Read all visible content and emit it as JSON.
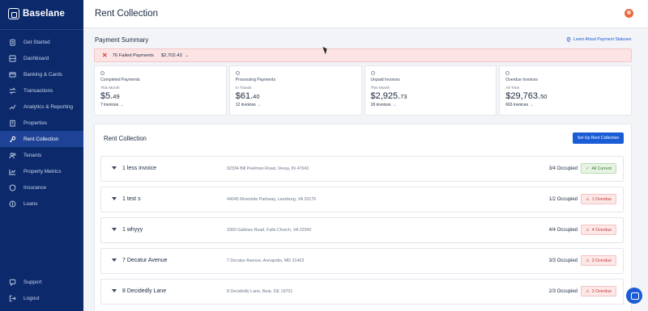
{
  "brand": {
    "name": "Baselane"
  },
  "header": {
    "title": "Rent Collection"
  },
  "sidebar": {
    "items": [
      {
        "label": "Get Started",
        "icon": "clipboard-icon",
        "active": false
      },
      {
        "label": "Dashboard",
        "icon": "dashboard-icon",
        "active": false
      },
      {
        "label": "Banking & Cards",
        "icon": "bank-icon",
        "active": false
      },
      {
        "label": "Transactions",
        "icon": "transactions-icon",
        "active": false
      },
      {
        "label": "Analytics & Reporting",
        "icon": "analytics-icon",
        "active": false
      },
      {
        "label": "Properties",
        "icon": "properties-icon",
        "active": false
      },
      {
        "label": "Rent Collection",
        "icon": "key-icon",
        "active": true
      },
      {
        "label": "Tenants",
        "icon": "tenants-icon",
        "active": false
      },
      {
        "label": "Property Metrics",
        "icon": "metrics-icon",
        "active": false
      },
      {
        "label": "Insurance",
        "icon": "shield-icon",
        "active": false
      },
      {
        "label": "Loans",
        "icon": "loans-icon",
        "active": false
      }
    ],
    "bottom": [
      {
        "label": "Support",
        "icon": "support-icon"
      },
      {
        "label": "Logout",
        "icon": "logout-icon"
      }
    ]
  },
  "payment_summary": {
    "title": "Payment Summary",
    "link": "Learn About Payment Statuses",
    "failed": {
      "label": "76 Failed Payments",
      "amount": "$2,702.43",
      "arrow": "→"
    },
    "cards": [
      {
        "title": "Completed Payments",
        "period": "This Month",
        "amount_main": "$5.",
        "amount_cents": "49",
        "link": "7 invoices  →"
      },
      {
        "title": "Processing Payments",
        "period": "In Transit",
        "amount_main": "$61.",
        "amount_cents": "40",
        "link": "12 invoices  →"
      },
      {
        "title": "Unpaid Invoices",
        "period": "This Month",
        "amount_main": "$2,925.",
        "amount_cents": "73",
        "link": "18 invoices  →"
      },
      {
        "title": "Overdue Invoices",
        "period": "All Time",
        "amount_main": "$29,763.",
        "amount_cents": "50",
        "link": "663 invoices  →"
      }
    ]
  },
  "rent_collection": {
    "title": "Rent Collection",
    "button": "Set Up Rent Collection",
    "rows": [
      {
        "name": "1 less invoice",
        "address": "92334 Bill Peelman Road, Vevay, IN 47043",
        "occupancy": "3/4 Occupied",
        "status": "All Current",
        "status_type": "ok"
      },
      {
        "name": "1 test s",
        "address": "44045 Riverside Parkway, Leesburg, VA 20176",
        "occupancy": "1/2 Occupied",
        "status": "1 Overdue",
        "status_type": "bad"
      },
      {
        "name": "1 whyyy",
        "address": "3300 Gallows Road, Falls Church, VA 22042",
        "occupancy": "4/4 Occupied",
        "status": "4 Overdue",
        "status_type": "bad"
      },
      {
        "name": "7 Decatur Avenue",
        "address": "7 Decatur Avenue, Annapolis, MD 21403",
        "occupancy": "3/3 Occupied",
        "status": "3 Overdue",
        "status_type": "bad"
      },
      {
        "name": "8 Decidedly Lane",
        "address": "8 Decidedly Lane, Bear, DE 19701",
        "occupancy": "2/3 Occupied",
        "status": "2 Overdue",
        "status_type": "bad"
      }
    ]
  },
  "colors": {
    "sidebar": "#0c2a6b",
    "accent": "#1a5cd6",
    "danger": "#c93838",
    "success": "#3f7a33"
  }
}
